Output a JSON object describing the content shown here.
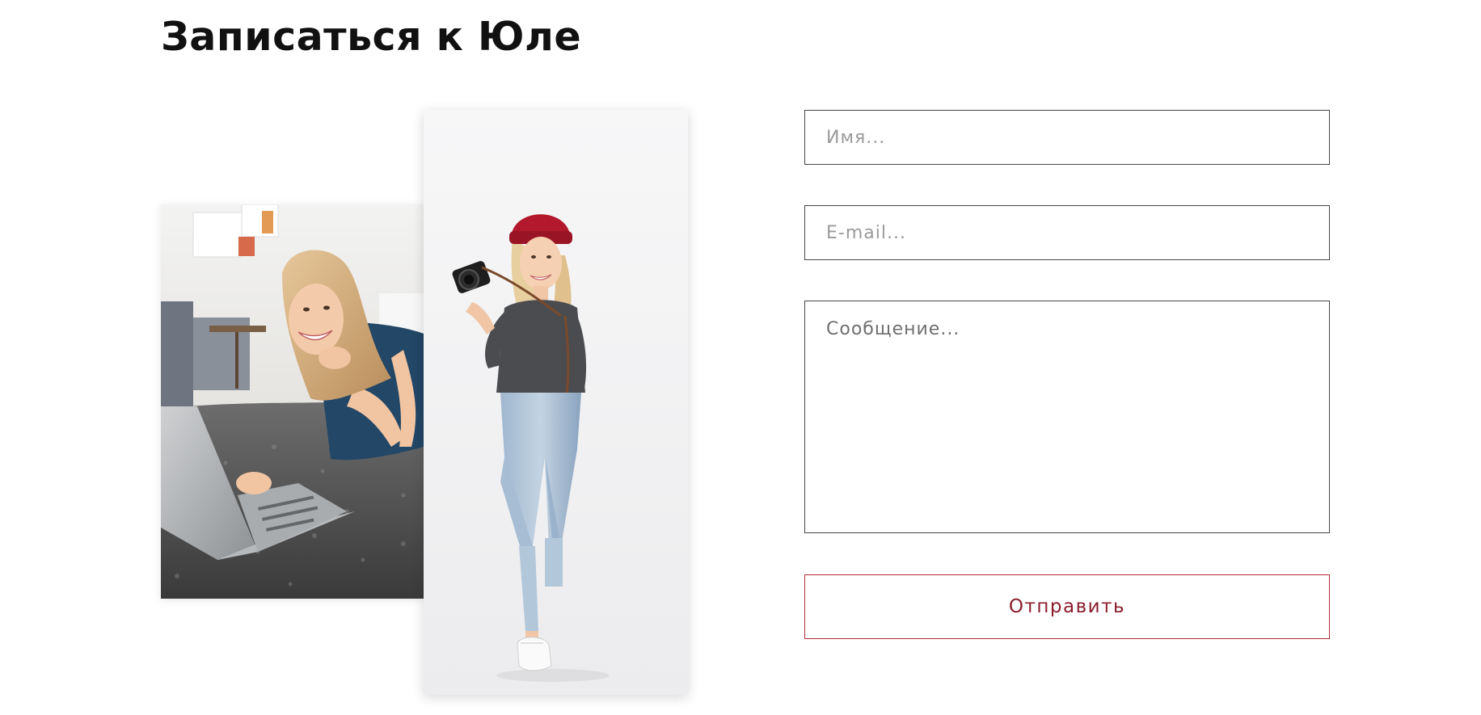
{
  "page": {
    "title": "Записаться к Юле"
  },
  "images": {
    "laptop_photo": "woman-lying-on-rug-with-laptop",
    "camera_photo": "woman-in-red-beanie-holding-camera"
  },
  "form": {
    "name_placeholder": "Имя...",
    "email_placeholder": "E-mail...",
    "message_placeholder": "Сообщение...",
    "submit_label": "Отправить"
  },
  "colors": {
    "accent": "#b5283a",
    "field_border": "#444444",
    "title": "#111111"
  }
}
